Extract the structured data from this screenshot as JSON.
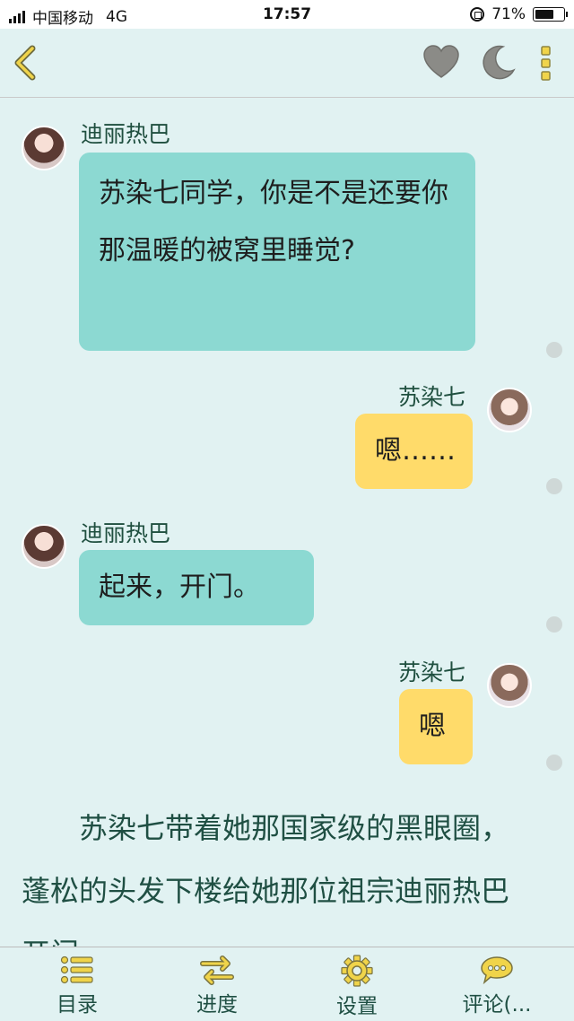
{
  "status_bar": {
    "carrier": "中国移动",
    "network": "4G",
    "time": "17:57",
    "battery_text": "71%",
    "battery_level": 0.71
  },
  "nav": {
    "icons": [
      "back-chevron-icon",
      "heart-icon",
      "moon-icon",
      "more-icon"
    ],
    "accent_color": "#f0d44a"
  },
  "messages": [
    {
      "side": "left",
      "sender": "迪丽热巴",
      "text": "苏染七同学，你是不是还要你那温暖的被窝里睡觉?"
    },
    {
      "side": "right",
      "sender": "苏染七",
      "text": "嗯……"
    },
    {
      "side": "left",
      "sender": "迪丽热巴",
      "text": "起来，开门。"
    },
    {
      "side": "right",
      "sender": "苏染七",
      "text": "嗯"
    }
  ],
  "narration": "苏染七带着她那国家级的黑眼圈，蓬松的头发下楼给她那位祖宗迪丽热巴开门",
  "bottom_nav": [
    {
      "label": "目录",
      "icon": "list-icon"
    },
    {
      "label": "进度",
      "icon": "arrows-icon"
    },
    {
      "label": "设置",
      "icon": "gear-icon"
    },
    {
      "label": "评论(...",
      "icon": "comment-icon"
    }
  ]
}
